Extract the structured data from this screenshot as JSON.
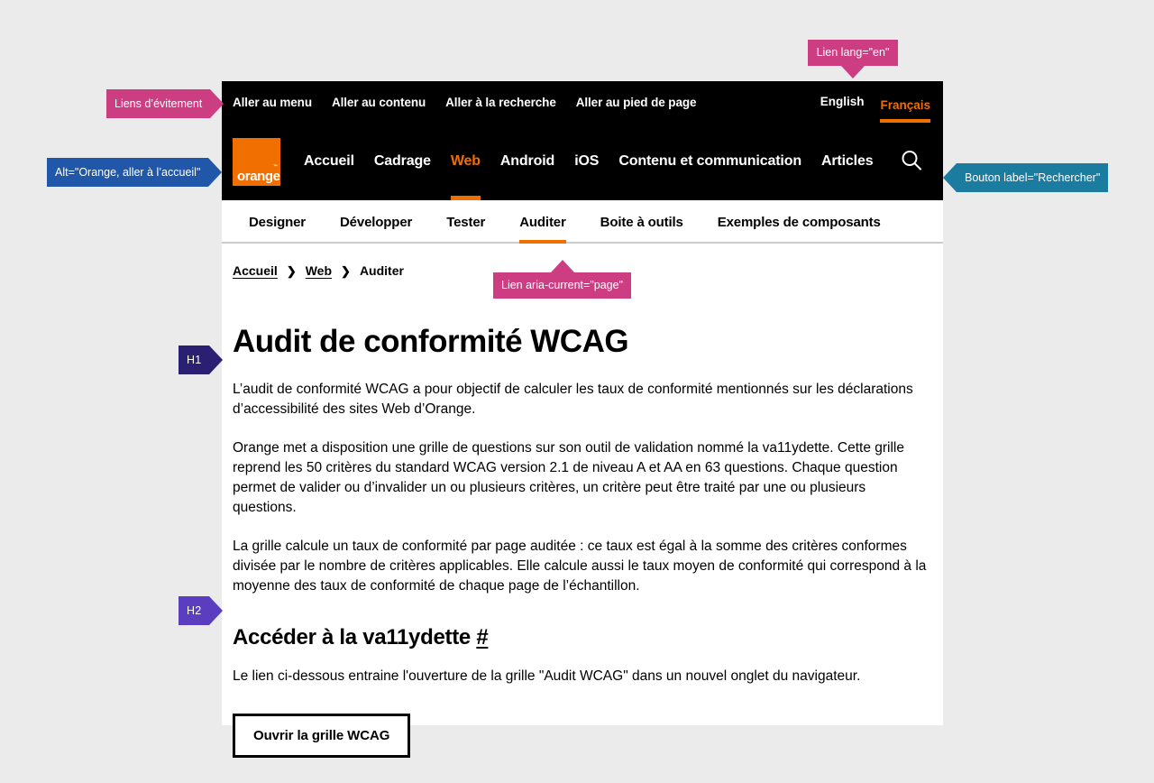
{
  "skipbar": {
    "links": [
      {
        "label": "Aller au menu"
      },
      {
        "label": "Aller au contenu"
      },
      {
        "label": "Aller à la recherche"
      },
      {
        "label": "Aller au pied de page"
      }
    ],
    "languages": [
      {
        "label": "English",
        "current": false
      },
      {
        "label": "Français",
        "current": true
      }
    ]
  },
  "header": {
    "logo_word": "orange",
    "logo_tm": "™",
    "search_icon": "search-icon",
    "nav": [
      {
        "label": "Accueil",
        "current": false
      },
      {
        "label": "Cadrage",
        "current": false
      },
      {
        "label": "Web",
        "current": true
      },
      {
        "label": "Android",
        "current": false
      },
      {
        "label": "iOS",
        "current": false
      },
      {
        "label": "Contenu et communication",
        "current": false
      },
      {
        "label": "Articles",
        "current": false
      }
    ]
  },
  "subnav": [
    {
      "label": "Designer",
      "current": false
    },
    {
      "label": "Développer",
      "current": false
    },
    {
      "label": "Tester",
      "current": false
    },
    {
      "label": "Auditer",
      "current": true
    },
    {
      "label": "Boite à outils",
      "current": false
    },
    {
      "label": "Exemples de composants",
      "current": false
    }
  ],
  "breadcrumb": {
    "items": [
      {
        "label": "Accueil",
        "link": true
      },
      {
        "label": "Web",
        "link": true
      },
      {
        "label": "Auditer",
        "link": false
      }
    ],
    "separator": "❯"
  },
  "main": {
    "h1": "Audit de conformité WCAG",
    "paragraphs": [
      "L’audit de conformité WCAG a pour objectif de calculer les taux de conformité mentionnés sur les déclarations d’accessibilité des sites Web d’Orange.",
      "Orange met a disposition une grille de questions sur son outil de validation nommé la va11ydette. Cette grille reprend les 50 critères du standard WCAG version 2.1 de niveau A et AA en 63 questions. Chaque question permet de valider ou d’invalider un ou plusieurs critères, un critère peut être traité par une ou plusieurs questions.",
      "La grille calcule un taux de conformité par page auditée : ce taux est égal à la somme des critères conformes divisée par le nombre de critères applicables. Elle calcule aussi le taux moyen de conformité qui correspond à la moyenne des taux de conformité de chaque page de l’échantillon."
    ],
    "h2": "Accéder à la va11ydette",
    "h2_anchor": "#",
    "intro_link": "Le lien ci-dessous entraine l'ouverture de la grille \"Audit WCAG\" dans un nouvel onglet du navigateur.",
    "button_label": "Ouvrir la grille WCAG"
  },
  "annotations": {
    "skip_links": "Liens d’évitement",
    "lang_en": "Lien lang=\"en\"",
    "logo_alt": "Alt=\"Orange, aller à l’accueil\"",
    "search_label": "Bouton label=\"Rechercher\"",
    "breadcrumb_current": "Lien aria-current=\"page\"",
    "h1_badge": "H1",
    "h2_badge": "H2"
  },
  "colors": {
    "orange": "#f16e00",
    "black": "#000000",
    "pink": "#cc3d82",
    "blue": "#2057a8",
    "teal": "#1b7ca0",
    "h1_badge": "#2a2073",
    "h2_badge": "#5b3ec0",
    "page_bg": "#ebebeb"
  }
}
